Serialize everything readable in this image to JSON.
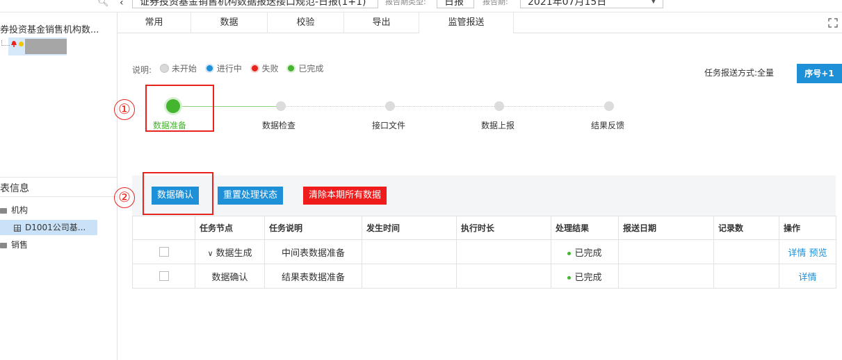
{
  "topbar": {
    "report_title": "证券投资基金销售机构数据报送接口规范-日报(1+1)",
    "period_type_label": "报告期类型:",
    "period_type_value": "日报",
    "period_label": "报告期:",
    "period_value": "2021年07月15日"
  },
  "sidebar": {
    "tree_title": "券投资基金销售机构数...",
    "section_title": "表信息",
    "items": [
      {
        "label": "机构"
      },
      {
        "label": "D1001公司基..."
      },
      {
        "label": "销售"
      }
    ]
  },
  "tabs": [
    {
      "label": "常用"
    },
    {
      "label": "数据"
    },
    {
      "label": "校验"
    },
    {
      "label": "导出"
    },
    {
      "label": "监管报送"
    }
  ],
  "legend": {
    "title": "说明:",
    "items": [
      {
        "label": "未开始",
        "color": "#d9d9d9"
      },
      {
        "label": "进行中",
        "color": "#1e90d8"
      },
      {
        "label": "失败",
        "color": "#e8231e"
      },
      {
        "label": "已完成",
        "color": "#44b52e"
      }
    ]
  },
  "report_mode": "任务报送方式:全量",
  "seq_button": "序号+1",
  "steps": [
    {
      "label": "数据准备",
      "status": "done"
    },
    {
      "label": "数据检查",
      "status": "pending"
    },
    {
      "label": "接口文件",
      "status": "pending"
    },
    {
      "label": "数据上报",
      "status": "pending"
    },
    {
      "label": "结果反馈",
      "status": "pending"
    }
  ],
  "annotations": [
    "①",
    "②"
  ],
  "actions": {
    "confirm": "数据确认",
    "reset": "重置处理状态",
    "clear": "清除本期所有数据"
  },
  "table": {
    "headers": [
      "",
      "任务节点",
      "任务说明",
      "发生时间",
      "执行时长",
      "处理结果",
      "报送日期",
      "记录数",
      "操作"
    ],
    "rows": [
      {
        "node": "数据生成",
        "desc": "中间表数据准备",
        "time": "",
        "duration": "",
        "result": "已完成",
        "date": "",
        "count": "",
        "ops": [
          "详情",
          "预览"
        ]
      },
      {
        "node": "数据确认",
        "desc": "结果表数据准备",
        "time": "",
        "duration": "",
        "result": "已完成",
        "date": "",
        "count": "",
        "ops": [
          "详情"
        ]
      }
    ]
  },
  "colors": {
    "accent": "#1e90d8",
    "danger": "#f01c1c",
    "success": "#44b52e",
    "annotation": "#e8231e"
  }
}
